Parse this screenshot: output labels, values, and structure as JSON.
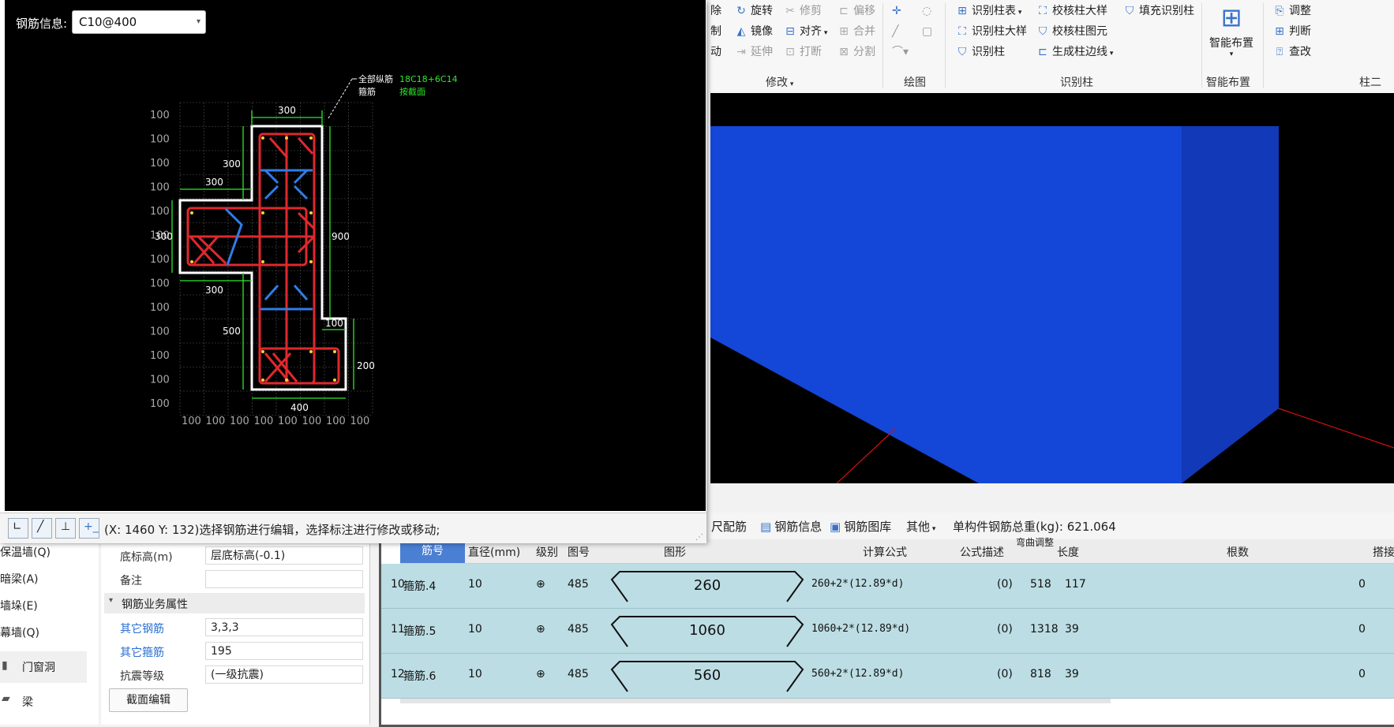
{
  "ribbon": {
    "modify": {
      "items": [
        {
          "label": "除",
          "icon": "delete-icon",
          "disabled": false
        },
        {
          "label": "旋转",
          "icon": "rotate-icon",
          "disabled": false
        },
        {
          "label": "修剪",
          "icon": "trim-icon",
          "disabled": true
        },
        {
          "label": "偏移",
          "icon": "offset-icon",
          "disabled": true
        },
        {
          "label": "制",
          "icon": "copy-icon",
          "disabled": false
        },
        {
          "label": "镜像",
          "icon": "mirror-icon",
          "disabled": false
        },
        {
          "label": "对齐",
          "icon": "align-icon",
          "disabled": false
        },
        {
          "label": "合并",
          "icon": "merge-icon",
          "disabled": true
        },
        {
          "label": "动",
          "icon": "move-icon",
          "disabled": false
        },
        {
          "label": "延伸",
          "icon": "extend-icon",
          "disabled": true
        },
        {
          "label": "打断",
          "icon": "break-icon",
          "disabled": true
        },
        {
          "label": "分割",
          "icon": "split-icon",
          "disabled": true
        }
      ],
      "group_label": "修改"
    },
    "draw": {
      "group_label": "绘图"
    },
    "recognize": {
      "items": [
        {
          "label": "识别柱表"
        },
        {
          "label": "校核柱大样"
        },
        {
          "label": "填充识别柱"
        },
        {
          "label": "识别柱大样"
        },
        {
          "label": "校核柱图元"
        },
        {
          "label": "识别柱"
        },
        {
          "label": "生成柱边线"
        }
      ],
      "group_label": "识别柱"
    },
    "smart": {
      "button_label": "智能布置",
      "group_label": "智能布置"
    },
    "column2": {
      "items": [
        {
          "label": "调整"
        },
        {
          "label": "判断"
        },
        {
          "label": "查改"
        }
      ],
      "group_label": "柱二"
    }
  },
  "edit_window": {
    "rebar_info_label": "钢筋信息:",
    "rebar_info_value": "C10@400",
    "status_text": "(X: 1460 Y: 132)选择钢筋进行编辑，选择标注进行修改或移动;"
  },
  "drawing": {
    "callout_labels": [
      "全部纵筋",
      "箍筋"
    ],
    "callout_values": [
      "18C18+6C14",
      "按截面"
    ],
    "grid_label": "100",
    "dims": [
      "300",
      "300",
      "300",
      "300",
      "900",
      "300",
      "500",
      "100",
      "200",
      "400"
    ]
  },
  "left_list": {
    "items": [
      "保温墙(Q)",
      "暗梁(A)",
      "墙垛(E)",
      "幕墙(Q)",
      "门窗洞",
      "梁"
    ]
  },
  "properties": {
    "rows": [
      {
        "label": "底标高(m)",
        "value": "层底标高(-0.1)",
        "link": false
      },
      {
        "label": "备注",
        "value": "",
        "link": false
      }
    ],
    "section_title": "钢筋业务属性",
    "rows2": [
      {
        "label": "其它钢筋",
        "value": "3,3,3",
        "link": true
      },
      {
        "label": "其它箍筋",
        "value": "195",
        "link": true
      },
      {
        "label": "抗震等级",
        "value": "(一级抗震)",
        "link": false
      }
    ],
    "section_edit_label": "截面编辑"
  },
  "rebar_toolbar": {
    "items": [
      "尺配筋",
      "钢筋信息",
      "钢筋图库",
      "其他"
    ],
    "total_weight": "单构件钢筋总重(kg): 621.064"
  },
  "rebar_table": {
    "headers": [
      "筋号",
      "直径(mm)",
      "级别",
      "图号",
      "图形",
      "计算公式",
      "公式描述",
      "弯曲调整",
      "长度",
      "根数",
      "搭接"
    ],
    "rows": [
      {
        "index": "10",
        "name": "箍筋.4",
        "diameter": "10",
        "grade": "⊕",
        "figure": "485",
        "shape_value": "260",
        "formula": "260+2*(12.89*d)",
        "bend": "(0)",
        "length": "518",
        "count": "117",
        "lap": "0"
      },
      {
        "index": "11",
        "name": "箍筋.5",
        "diameter": "10",
        "grade": "⊕",
        "figure": "485",
        "shape_value": "1060",
        "formula": "1060+2*(12.89*d)",
        "bend": "(0)",
        "length": "1318",
        "count": "39",
        "lap": "0"
      },
      {
        "index": "12",
        "name": "箍筋.6",
        "diameter": "10",
        "grade": "⊕",
        "figure": "485",
        "shape_value": "560",
        "formula": "560+2*(12.89*d)",
        "bend": "(0)",
        "length": "818",
        "count": "39",
        "lap": "0"
      }
    ]
  },
  "colors": {
    "rebar_red": "#e0282d",
    "tie_blue": "#2f7de8",
    "dim_green": "#2ee82e",
    "viewport_blue": "#1446d8"
  }
}
